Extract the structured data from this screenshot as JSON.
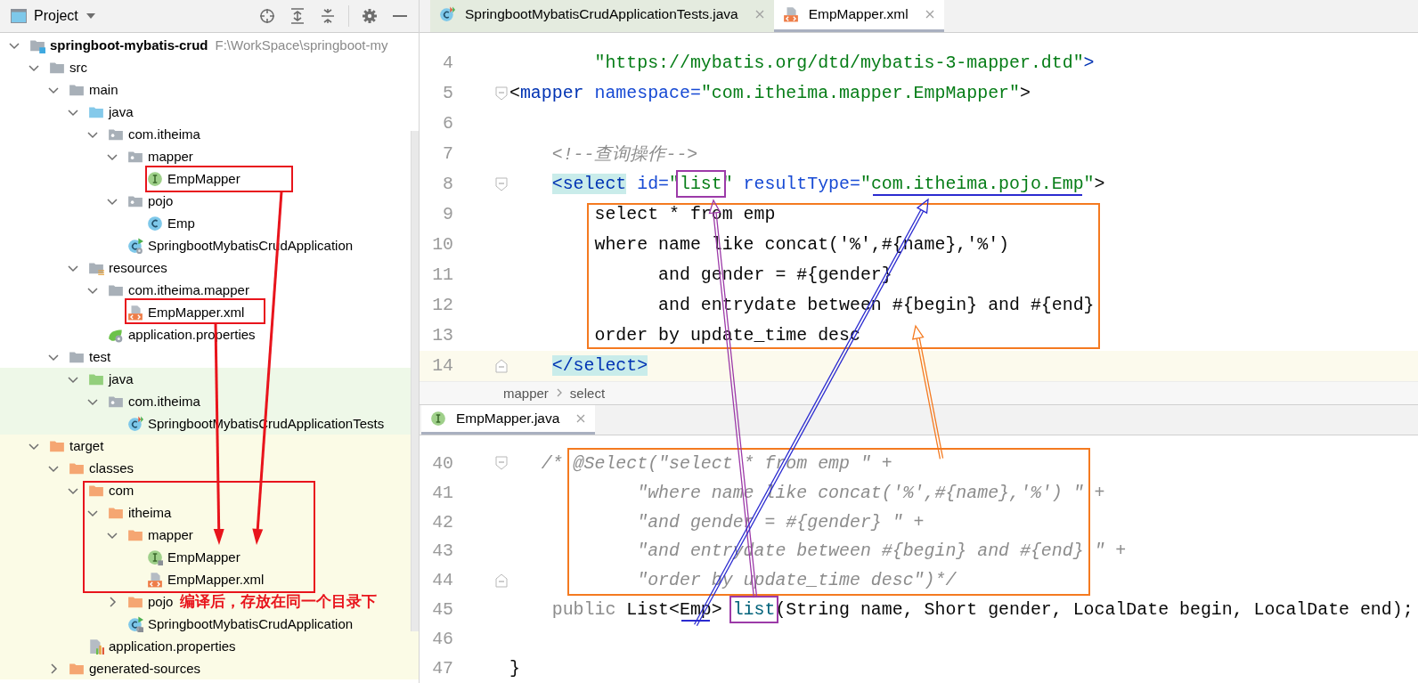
{
  "project_panel": {
    "title": "Project",
    "tree": [
      {
        "label": "springboot-mybatis-crud",
        "kind": "module",
        "path": "F:\\WorkSpace\\springboot-my",
        "expanded": true,
        "children": [
          {
            "label": "src",
            "kind": "folder",
            "expanded": true,
            "children": [
              {
                "label": "main",
                "kind": "folder",
                "expanded": true,
                "children": [
                  {
                    "label": "java",
                    "kind": "source-root",
                    "expanded": true,
                    "children": [
                      {
                        "label": "com.itheima",
                        "kind": "package",
                        "expanded": true,
                        "children": [
                          {
                            "label": "mapper",
                            "kind": "package",
                            "expanded": true,
                            "children": [
                              {
                                "label": "EmpMapper",
                                "kind": "interface"
                              }
                            ]
                          },
                          {
                            "label": "pojo",
                            "kind": "package",
                            "expanded": true,
                            "children": [
                              {
                                "label": "Emp",
                                "kind": "class"
                              }
                            ]
                          },
                          {
                            "label": "SpringbootMybatisCrudApplication",
                            "kind": "spring-app"
                          }
                        ]
                      }
                    ]
                  },
                  {
                    "label": "resources",
                    "kind": "resources-root",
                    "expanded": true,
                    "children": [
                      {
                        "label": "com.itheima.mapper",
                        "kind": "folder",
                        "expanded": true,
                        "children": [
                          {
                            "label": "EmpMapper.xml",
                            "kind": "xml"
                          }
                        ]
                      },
                      {
                        "label": "application.properties",
                        "kind": "spring-properties"
                      }
                    ]
                  }
                ]
              },
              {
                "label": "test",
                "kind": "folder",
                "expanded": true,
                "children": [
                  {
                    "label": "java",
                    "kind": "test-root",
                    "test_source": true,
                    "expanded": true,
                    "children": [
                      {
                        "label": "com.itheima",
                        "kind": "package",
                        "test_source": true,
                        "expanded": true,
                        "children": [
                          {
                            "label": "SpringbootMybatisCrudApplicationTests",
                            "kind": "test-class",
                            "test_source": true
                          }
                        ]
                      }
                    ]
                  }
                ]
              }
            ]
          },
          {
            "label": "target",
            "kind": "excluded",
            "excluded": true,
            "expanded": true,
            "children": [
              {
                "label": "classes",
                "kind": "excluded",
                "excluded": true,
                "expanded": true,
                "children": [
                  {
                    "label": "com",
                    "kind": "excluded",
                    "excluded": true,
                    "expanded": true,
                    "children": [
                      {
                        "label": "itheima",
                        "kind": "excluded",
                        "excluded": true,
                        "expanded": true,
                        "children": [
                          {
                            "label": "mapper",
                            "kind": "excluded",
                            "excluded": true,
                            "expanded": true,
                            "children": [
                              {
                                "label": "EmpMapper",
                                "kind": "interface",
                                "excluded": true,
                                "locked": true
                              },
                              {
                                "label": "EmpMapper.xml",
                                "kind": "xml",
                                "excluded": true
                              }
                            ]
                          },
                          {
                            "label": "pojo",
                            "kind": "excluded",
                            "excluded": true,
                            "expanded": false,
                            "note": "编译后，存放在同一个目录下"
                          },
                          {
                            "label": "SpringbootMybatisCrudApplication",
                            "kind": "spring-app",
                            "excluded": true,
                            "locked": true
                          }
                        ]
                      }
                    ]
                  },
                  {
                    "label": "application.properties",
                    "kind": "properties",
                    "excluded": true
                  }
                ]
              },
              {
                "label": "generated-sources",
                "kind": "excluded",
                "excluded": true,
                "expanded": false
              }
            ]
          }
        ]
      }
    ]
  },
  "editor_tabs": [
    {
      "label": "SpringbootMybatisCrudApplicationTests.java",
      "kind": "test-class",
      "test_source": true,
      "selected": false
    },
    {
      "label": "EmpMapper.xml",
      "kind": "xml",
      "selected": true
    }
  ],
  "xml_editor": {
    "lines": [
      {
        "number": "4",
        "current": false,
        "tokens": [
          {
            "text": "        \"https://mybatis.org/dtd/mybatis-3-mapper.dtd\"",
            "kind": "value"
          },
          {
            "text": ">",
            "kind": "tag"
          }
        ]
      },
      {
        "number": "5",
        "current": false,
        "kind": "fold-start",
        "tokens": [
          {
            "text": "<",
            "kind": "plain"
          },
          {
            "text": "mapper",
            "kind": "tag"
          },
          {
            "text": " namespace=",
            "kind": "attr"
          },
          {
            "text": "\"com.itheima.mapper.EmpMapper\"",
            "kind": "value"
          },
          {
            "text": ">",
            "kind": "plain"
          }
        ]
      },
      {
        "number": "6",
        "current": false
      },
      {
        "number": "7",
        "current": false,
        "tokens": [
          {
            "text": "    <!--查询操作-->",
            "kind": "comment"
          }
        ]
      },
      {
        "number": "8",
        "current": false,
        "kind": "fold-start",
        "tokens": [
          {
            "text": "    <select",
            "kind": "tag-match"
          },
          {
            "text": " id=",
            "kind": "attr"
          },
          {
            "text": "\"",
            "kind": "value"
          },
          {
            "text": "list",
            "kind": "value",
            "boxed": true
          },
          {
            "text": "\"",
            "kind": "value"
          },
          {
            "text": " resultType=",
            "kind": "attr"
          },
          {
            "text": "\"",
            "kind": "value"
          },
          {
            "text": "com.itheima.pojo.Emp",
            "kind": "value",
            "underlined": true
          },
          {
            "text": "\"",
            "kind": "value"
          },
          {
            "text": ">",
            "kind": "plain"
          }
        ]
      },
      {
        "number": "9",
        "current": false,
        "tokens": [
          {
            "text": "        select * from emp",
            "kind": "plain"
          }
        ]
      },
      {
        "number": "10",
        "current": false,
        "tokens": [
          {
            "text": "        where name like concat('%',#{name},'%')",
            "kind": "plain"
          }
        ]
      },
      {
        "number": "11",
        "current": false,
        "tokens": [
          {
            "text": "              and gender = #{gender}",
            "kind": "plain"
          }
        ]
      },
      {
        "number": "12",
        "current": false,
        "tokens": [
          {
            "text": "              and entrydate between #{begin} and #{end}",
            "kind": "plain"
          }
        ]
      },
      {
        "number": "13",
        "current": false,
        "tokens": [
          {
            "text": "        order by update_time desc",
            "kind": "plain"
          }
        ]
      },
      {
        "number": "14",
        "current": true,
        "kind": "fold-end",
        "tokens": [
          {
            "text": "    </select>",
            "kind": "tag-match"
          }
        ]
      }
    ]
  },
  "breadcrumb": [
    "mapper",
    "select"
  ],
  "java_tabs": [
    {
      "label": "EmpMapper.java",
      "kind": "interface",
      "selected": true
    }
  ],
  "java_editor": {
    "lines": [
      {
        "number": "40",
        "current": false,
        "kind": "fold-start",
        "tokens": [
          {
            "text": "   /* @Select(\"select * from emp \" +",
            "kind": "comment"
          }
        ]
      },
      {
        "number": "41",
        "current": false,
        "tokens": [
          {
            "text": "            \"where name like concat('%',#{name},'%') \" +",
            "kind": "comment"
          }
        ]
      },
      {
        "number": "42",
        "current": false,
        "tokens": [
          {
            "text": "            \"and gender = #{gender} \" +",
            "kind": "comment"
          }
        ]
      },
      {
        "number": "43",
        "current": false,
        "tokens": [
          {
            "text": "            \"and entrydate between #{begin} and #{end} \" +",
            "kind": "comment"
          }
        ]
      },
      {
        "number": "44",
        "current": false,
        "kind": "fold-end",
        "tokens": [
          {
            "text": "            \"order by update_time desc\")*/",
            "kind": "comment"
          }
        ]
      },
      {
        "number": "45",
        "current": false,
        "tokens": [
          {
            "text": "    public",
            "kind": "muted"
          },
          {
            "text": " List<",
            "kind": "plain"
          },
          {
            "text": "Emp",
            "kind": "plain",
            "underlined": true
          },
          {
            "text": "> ",
            "kind": "plain"
          },
          {
            "text": "list",
            "kind": "method",
            "boxed": true
          },
          {
            "text": "(String name, Short gender, LocalDate begin, LocalDate end);",
            "kind": "plain"
          }
        ]
      },
      {
        "number": "46",
        "current": false
      },
      {
        "number": "47",
        "current": false,
        "tokens": [
          {
            "text": "}",
            "kind": "plain"
          }
        ]
      }
    ]
  }
}
